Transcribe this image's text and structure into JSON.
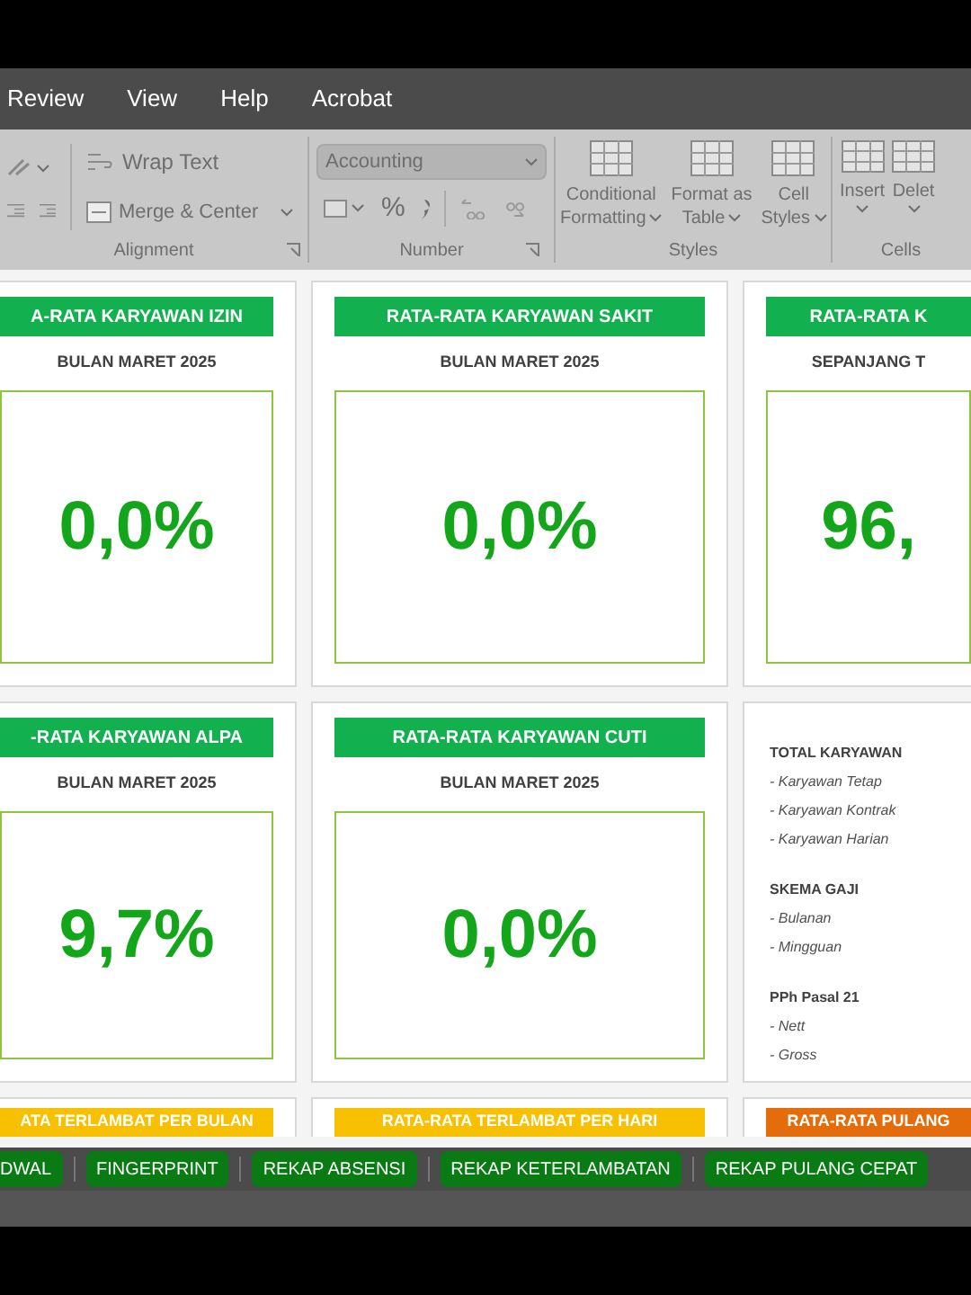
{
  "menu": [
    "Review",
    "View",
    "Help",
    "Acrobat"
  ],
  "ribbon": {
    "alignment": {
      "label": "Alignment",
      "wrap_text": "Wrap Text",
      "merge_center": "Merge & Center"
    },
    "number": {
      "label": "Number",
      "format": "Accounting",
      "percent": "%"
    },
    "styles": {
      "label": "Styles",
      "buttons": [
        {
          "lines": [
            "Conditional",
            "Formatting"
          ]
        },
        {
          "lines": [
            "Format as",
            "Table"
          ]
        },
        {
          "lines": [
            "Cell",
            "Styles"
          ]
        }
      ]
    },
    "cells": {
      "label": "Cells",
      "buttons": [
        "Insert",
        "Delet"
      ]
    }
  },
  "cards": [
    {
      "kind": "metric",
      "title": "A-RATA KARYAWAN IZIN",
      "color": "#13b04f",
      "subtitle": "BULAN MARET 2025",
      "value": "0,0%"
    },
    {
      "kind": "metric",
      "title": "RATA-RATA KARYAWAN SAKIT",
      "color": "#13b04f",
      "subtitle": "BULAN MARET 2025",
      "value": "0,0%"
    },
    {
      "kind": "metric",
      "title": "RATA-RATA K",
      "color": "#13b04f",
      "subtitle": "SEPANJANG T",
      "value": "96,"
    },
    {
      "kind": "metric",
      "title": "-RATA KARYAWAN ALPA",
      "color": "#13b04f",
      "subtitle": "BULAN MARET 2025",
      "value": "9,7%"
    },
    {
      "kind": "metric",
      "title": "RATA-RATA KARYAWAN CUTI",
      "color": "#13b04f",
      "subtitle": "BULAN MARET 2025",
      "value": "0,0%"
    },
    {
      "kind": "info",
      "sections": [
        {
          "heading": "TOTAL KARYAWAN",
          "items": [
            "- Karyawan Tetap",
            "- Karyawan Kontrak",
            "- Karyawan Harian"
          ]
        },
        {
          "heading": "SKEMA GAJI",
          "items": [
            "- Bulanan",
            "- Mingguan"
          ]
        },
        {
          "heading": "PPh Pasal 21",
          "items": [
            "- Nett",
            "- Gross"
          ]
        }
      ]
    },
    {
      "kind": "header",
      "title": "ATA TERLAMBAT PER BULAN",
      "color": "#f7c000"
    },
    {
      "kind": "header",
      "title": "RATA-RATA TERLAMBAT PER HARI",
      "color": "#f7c000"
    },
    {
      "kind": "header",
      "title": "RATA-RATA PULANG",
      "color": "#e46c0a"
    }
  ],
  "sheet_tabs": [
    {
      "label": "DWAL",
      "selected": false
    },
    {
      "label": "FINGERPRINT",
      "selected": false
    },
    {
      "label": "REKAP ABSENSI",
      "selected": false
    },
    {
      "label": "REKAP KETERLAMBATAN",
      "selected": false
    },
    {
      "label": "REKAP PULANG CEPAT",
      "selected": false
    }
  ]
}
